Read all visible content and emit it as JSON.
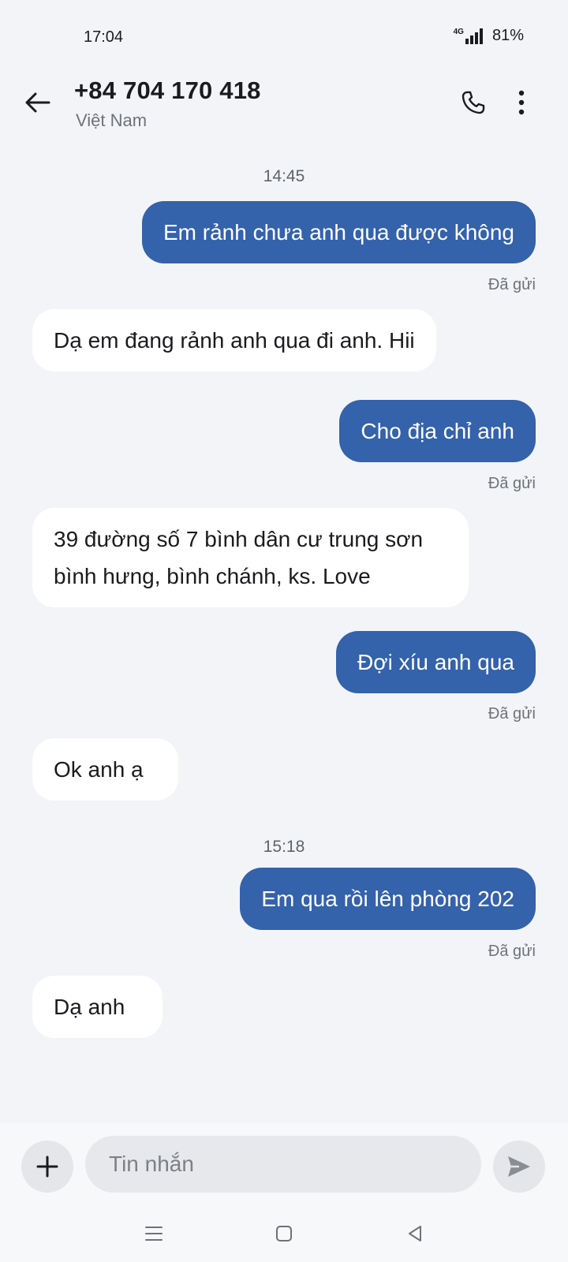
{
  "status_bar": {
    "time": "17:04",
    "network": "4G",
    "battery": "81%"
  },
  "header": {
    "contact_number": "+84 704 170 418",
    "contact_country": "Việt Nam"
  },
  "conversation": {
    "time_separators": [
      "14:45",
      "15:18"
    ],
    "messages": [
      {
        "direction": "out",
        "text": "Em rảnh chưa anh qua được không",
        "status": "Đã gửi"
      },
      {
        "direction": "in",
        "text": "Dạ em đang rảnh anh qua đi anh. Hii"
      },
      {
        "direction": "out",
        "text": "Cho địa chỉ anh",
        "status": "Đã gửi"
      },
      {
        "direction": "in",
        "lines": [
          "39 đường số 7 bình dân cư trung sơn",
          "bình hưng, bình chánh, ks. Love"
        ]
      },
      {
        "direction": "out",
        "text": "Đợi xíu anh qua",
        "status": "Đã gửi"
      },
      {
        "direction": "in",
        "text": "Ok anh ạ"
      },
      {
        "direction": "out",
        "text": "Em qua rồi lên phòng 202",
        "status": "Đã gửi"
      },
      {
        "direction": "in",
        "text": "Dạ anh"
      }
    ]
  },
  "compose": {
    "placeholder": "Tin nhắn",
    "value": ""
  },
  "icons": {
    "back": "arrow-left-icon",
    "call": "phone-icon",
    "more": "more-vert-icon",
    "add": "plus-icon",
    "send": "send-icon",
    "nav_menu": "menu-icon",
    "nav_home": "square-icon",
    "nav_back": "triangle-back-icon"
  },
  "colors": {
    "outgoing_bubble": "#3462ab",
    "incoming_bubble": "#ffffff",
    "background": "#f2f4f7"
  }
}
